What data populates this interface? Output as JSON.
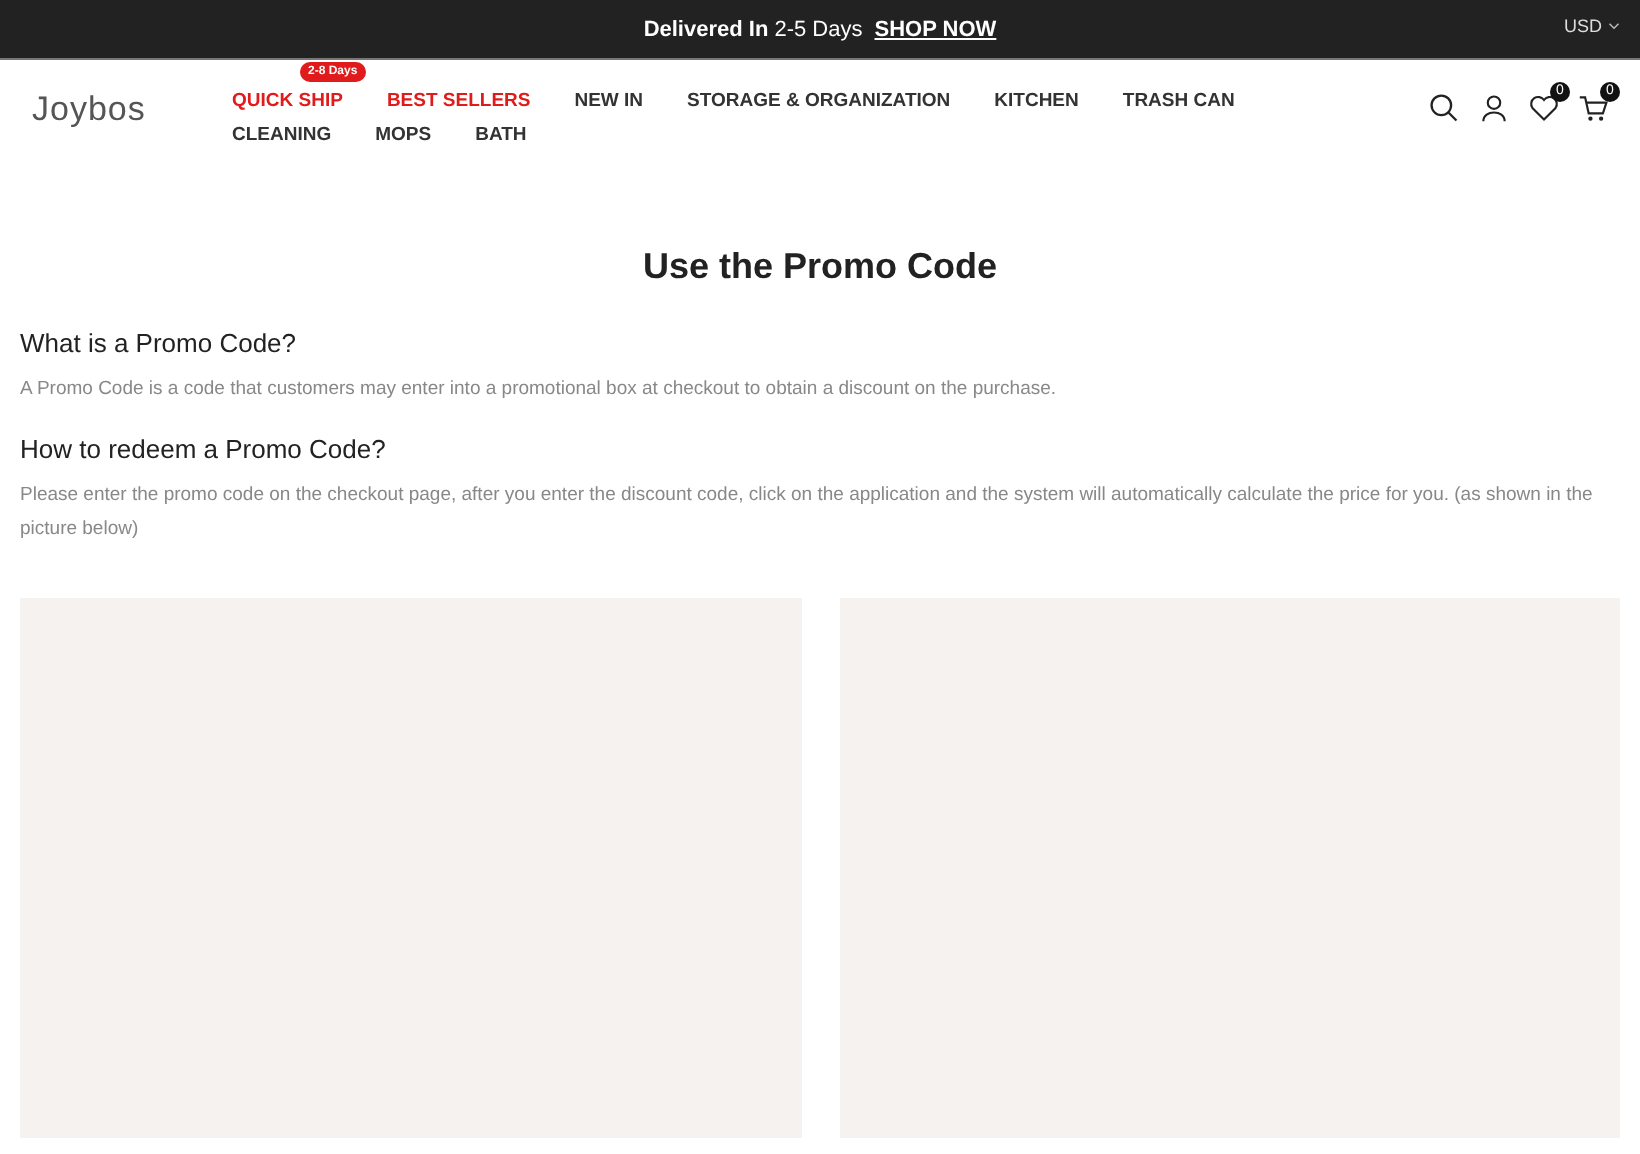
{
  "announcement": {
    "text": "**Delivered In** 2-5 Days",
    "link": "SHOP NOW",
    "currency": "USD"
  },
  "header": {
    "logo": "Joybos",
    "nav": [
      {
        "label": "QUICK SHIP",
        "featured": true,
        "badge": "2-8 Days"
      },
      {
        "label": "BEST SELLERS",
        "featured": true
      },
      {
        "label": "NEW IN",
        "featured": false
      },
      {
        "label": "STORAGE & ORGANIZATION",
        "featured": false
      },
      {
        "label": "KITCHEN",
        "featured": false
      },
      {
        "label": "TRASH CAN",
        "featured": false
      },
      {
        "label": "CLEANING",
        "featured": false
      },
      {
        "label": "MOPS",
        "featured": false
      },
      {
        "label": "BATH",
        "featured": false
      }
    ],
    "wishlist_count": "0",
    "cart_count": "0"
  },
  "page": {
    "title": "Use the Promo Code",
    "sections": [
      {
        "heading": "What is a Promo Code?",
        "body": "A Promo Code is a code that customers may enter into a promotional box at checkout to obtain a discount on the purchase."
      },
      {
        "heading": "How to redeem a Promo Code?",
        "body": "Please enter the promo code on the checkout page, after you enter the discount code, click on the application and the system will automatically calculate the price for you. (as shown in the picture below)"
      }
    ],
    "images": [
      {
        "kind": "placeholder"
      },
      {
        "kind": "placeholder"
      }
    ]
  }
}
